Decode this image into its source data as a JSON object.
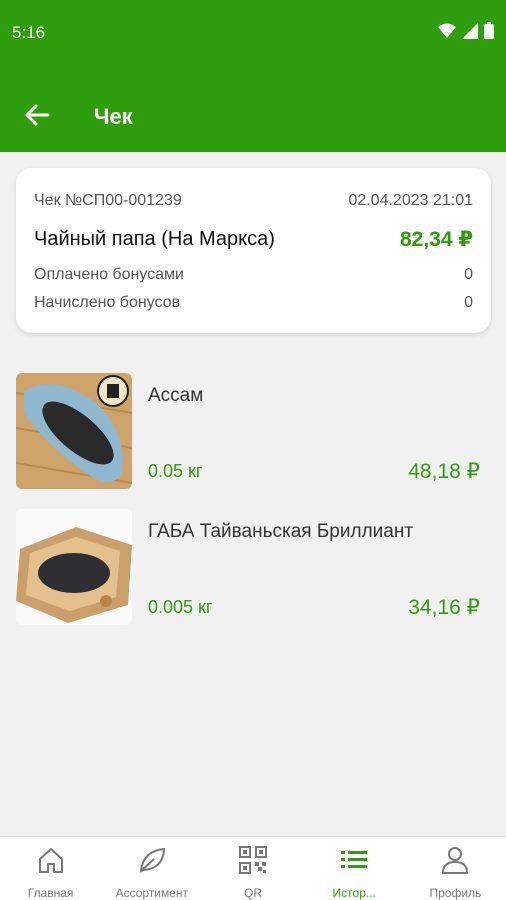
{
  "status_bar": {
    "time": "5:16"
  },
  "app_bar": {
    "title": "Чек"
  },
  "receipt": {
    "number": "Чек №СП00-001239",
    "datetime": "02.04.2023 21:01",
    "shop": "Чайный папа (На Маркса)",
    "total": "82,34 ₽",
    "rows": [
      {
        "label": "Оплачено бонусами",
        "value": "0"
      },
      {
        "label": "Начислено бонусов",
        "value": "0"
      }
    ]
  },
  "items": [
    {
      "name": "Ассам",
      "quantity": "0.05 кг",
      "price": "48,18 ₽"
    },
    {
      "name": "ГАБА Тайваньская Бриллиант",
      "quantity": "0.005 кг",
      "price": "34,16 ₽"
    }
  ],
  "bottom_nav": [
    {
      "label": "Главная",
      "icon": "home-icon"
    },
    {
      "label": "Ассортимент",
      "icon": "leaf-icon"
    },
    {
      "label": "QR",
      "icon": "qr-code-icon"
    },
    {
      "label": "Истор...",
      "icon": "list-icon",
      "active": true
    },
    {
      "label": "Профиль",
      "icon": "user-icon"
    }
  ],
  "colors": {
    "accent": "#2e9e0c",
    "background": "#f1f1f1",
    "card": "#ffffff"
  }
}
